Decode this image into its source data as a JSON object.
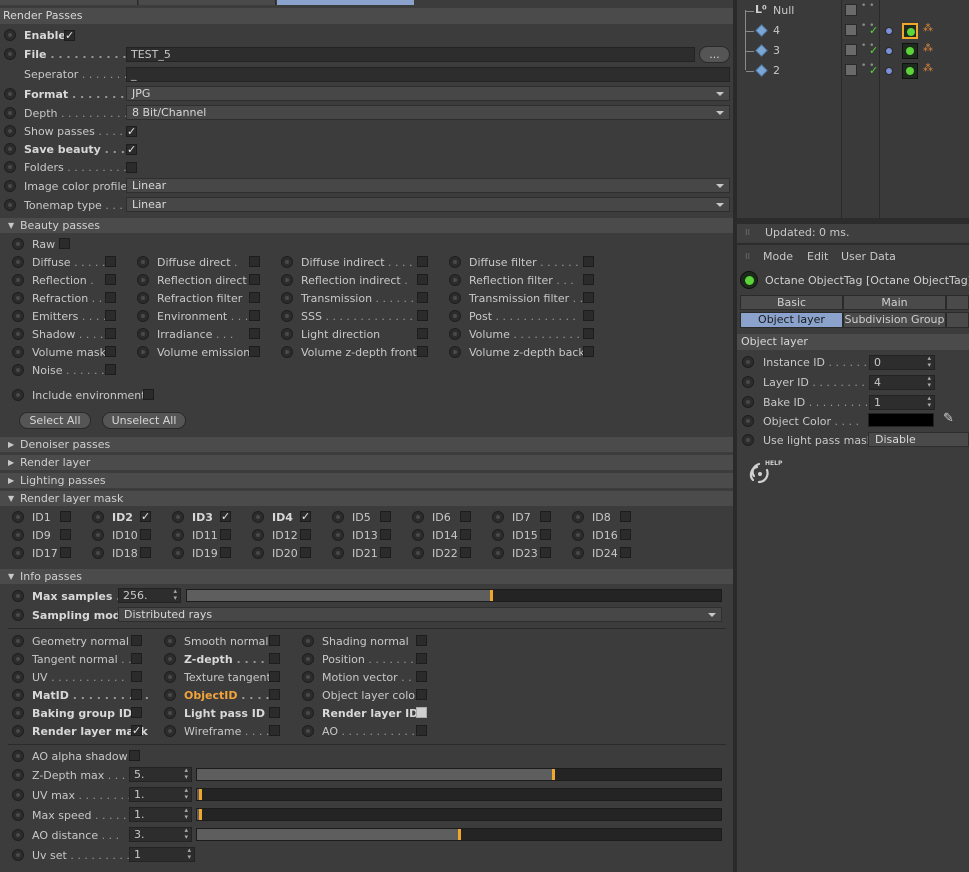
{
  "render_passes": {
    "title": "Render Passes",
    "enable": {
      "label": "Enable",
      "checked": true
    },
    "file": {
      "label": "File",
      "value": "TEST_5",
      "browse": "..."
    },
    "separator": {
      "label": "Seperator",
      "value": "_"
    },
    "format": {
      "label": "Format",
      "value": "JPG"
    },
    "depth": {
      "label": "Depth",
      "value": "8 Bit/Channel"
    },
    "show_passes": {
      "label": "Show passes",
      "checked": true
    },
    "save_beauty": {
      "label": "Save beauty",
      "checked": true
    },
    "folders": {
      "label": "Folders",
      "checked": false
    },
    "image_color_profile": {
      "label": "Image color profile",
      "value": "Linear"
    },
    "tonemap_type": {
      "label": "Tonemap type",
      "value": "Linear"
    }
  },
  "beauty": {
    "title": "Beauty passes",
    "raw": "Raw",
    "items": [
      [
        "Diffuse",
        "Diffuse direct",
        "Diffuse indirect",
        "Diffuse filter"
      ],
      [
        "Reflection",
        "Reflection direct",
        "Reflection indirect",
        "Reflection filter"
      ],
      [
        "Refraction",
        "Refraction filter",
        "Transmission",
        "Transmission filter"
      ],
      [
        "Emitters",
        "Environment",
        "SSS",
        "Post"
      ],
      [
        "Shadow",
        "Irradiance",
        "Light direction",
        "Volume"
      ],
      [
        "Volume mask",
        "Volume emission",
        "Volume z-depth front",
        "Volume z-depth back"
      ],
      [
        "Noise"
      ]
    ],
    "include_environment": "Include environment",
    "select_all": "Select All",
    "unselect_all": "Unselect All"
  },
  "collapsed_sections": [
    "Denoiser passes",
    "Render layer",
    "Lighting passes"
  ],
  "render_layer_mask": {
    "title": "Render layer mask",
    "ids": [
      "ID1",
      "ID2",
      "ID3",
      "ID4",
      "ID5",
      "ID6",
      "ID7",
      "ID8",
      "ID9",
      "ID10",
      "ID11",
      "ID12",
      "ID13",
      "ID14",
      "ID15",
      "ID16",
      "ID17",
      "ID18",
      "ID19",
      "ID20",
      "ID21",
      "ID22",
      "ID23",
      "ID24"
    ],
    "checked": [
      "ID2",
      "ID3",
      "ID4"
    ]
  },
  "info": {
    "title": "Info passes",
    "max_samples": {
      "label": "Max samples",
      "value": "256.",
      "fraction": 0.57
    },
    "sampling_mode": {
      "label": "Sampling mode",
      "value": "Distributed rays"
    },
    "rows": [
      [
        "Geometry normal",
        "Smooth normal",
        "Shading normal"
      ],
      [
        "Tangent normal",
        "Z-depth",
        "Position"
      ],
      [
        "UV",
        "Texture tangent",
        "Motion vector"
      ],
      [
        "MatID",
        "ObjectID",
        "Object layer color"
      ],
      [
        "Baking group ID",
        "Light pass ID",
        "Render layer ID"
      ],
      [
        "Render layer mask",
        "Wireframe",
        "AO"
      ]
    ],
    "ao_alpha_shadow": "AO alpha shadow",
    "z_depth_max": {
      "label": "Z-Depth max",
      "value": "5.",
      "fraction": 0.68
    },
    "uv_max": {
      "label": "UV max",
      "value": "1.",
      "fraction": 0.005
    },
    "max_speed": {
      "label": "Max speed",
      "value": "1.",
      "fraction": 0.005
    },
    "ao_distance": {
      "label": "AO distance",
      "value": "3.",
      "fraction": 0.5
    },
    "uv_set": {
      "label": "Uv set",
      "value": "1"
    }
  },
  "objects": {
    "items": [
      "Null",
      "4",
      "3",
      "2"
    ]
  },
  "status": "Updated: 0 ms.",
  "attr": {
    "menu": [
      "Mode",
      "Edit",
      "User Data"
    ],
    "tag_title": "Octane ObjectTag [Octane ObjectTag]",
    "tabs_row1": [
      "Basic",
      "Main"
    ],
    "tabs_row2": [
      "Object layer",
      "Subdivision Group"
    ],
    "section": "Object layer",
    "instance_id": {
      "label": "Instance ID",
      "value": "0"
    },
    "layer_id": {
      "label": "Layer ID",
      "value": "4"
    },
    "bake_id": {
      "label": "Bake ID",
      "value": "1"
    },
    "object_color": {
      "label": "Object Color",
      "value": "#000000"
    },
    "use_light_pass_mask": {
      "label": "Use light pass mask",
      "value": "Disable"
    },
    "help": "HELP"
  },
  "colors": {
    "accent": "#f1a82a",
    "active_tab": "#8ba3cc",
    "orange_text": "#f2a43a"
  }
}
